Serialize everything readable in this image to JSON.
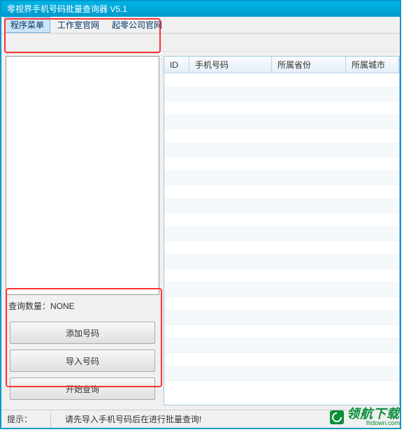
{
  "window": {
    "title": "零视界手机号码批量查询器 V5.1"
  },
  "menu": {
    "items": [
      {
        "label": "程序菜单",
        "active": true
      },
      {
        "label": "工作室官网",
        "active": false
      },
      {
        "label": "起零公司官网",
        "active": false
      }
    ]
  },
  "left": {
    "query_count_label": "查询数量：",
    "query_count_value": "NONE",
    "buttons": {
      "add": "添加号码",
      "import": "导入号码",
      "start": "开始查询"
    }
  },
  "table": {
    "headers": {
      "id": "ID",
      "phone": "手机号码",
      "province": "所属省份",
      "city": "所属城市"
    }
  },
  "status": {
    "label": "提示：",
    "text": "请先导入手机号码后在进行批量查询!"
  },
  "watermark": {
    "main": "领航下载",
    "sub": "lhdown.com"
  }
}
